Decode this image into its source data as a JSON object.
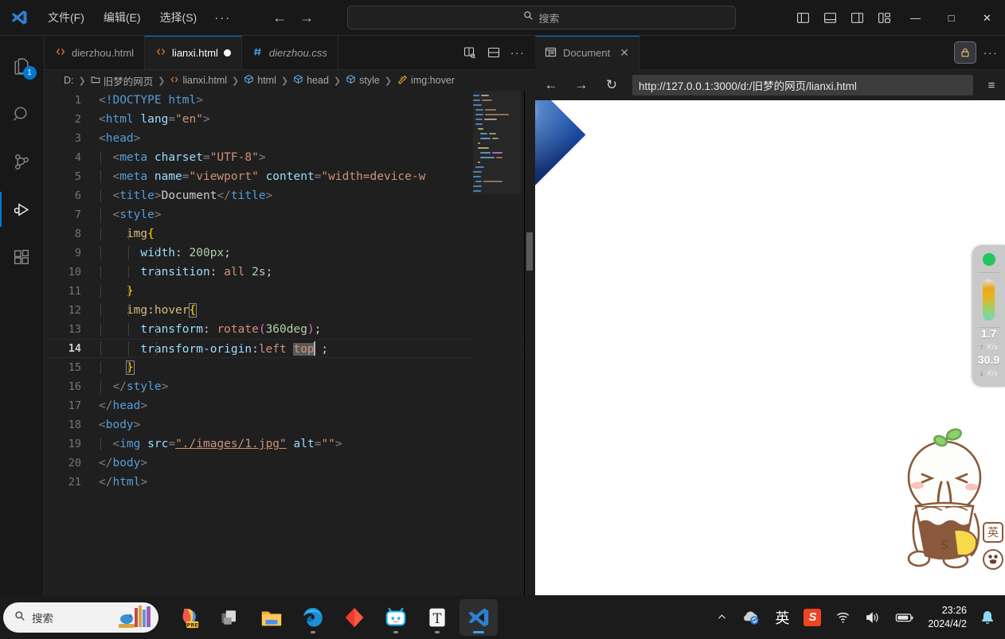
{
  "titlebar": {
    "logo_icon": "vscode-logo-icon",
    "menus": [
      {
        "label": "文件(F)",
        "name": "menu-file"
      },
      {
        "label": "编辑(E)",
        "name": "menu-edit"
      },
      {
        "label": "选择(S)",
        "name": "menu-selection"
      },
      {
        "label": "···",
        "name": "menu-more"
      }
    ],
    "back_arrow": "←",
    "forward_arrow": "→",
    "search": {
      "placeholder": "搜索",
      "icon": "search-icon"
    },
    "layout_buttons": [
      {
        "name": "toggle-primary-sidebar-icon"
      },
      {
        "name": "toggle-panel-icon"
      },
      {
        "name": "toggle-secondary-sidebar-icon"
      },
      {
        "name": "customize-layout-icon"
      }
    ],
    "window_buttons": {
      "minimize": "—",
      "maximize": "□",
      "close": "✕"
    }
  },
  "activitybar": {
    "items": [
      {
        "name": "sidebar-item-explorer",
        "icon": "files-icon",
        "badge": "1",
        "active": false
      },
      {
        "name": "sidebar-item-search",
        "icon": "search-icon",
        "badge": "",
        "active": false
      },
      {
        "name": "sidebar-item-source-control",
        "icon": "source-control-icon",
        "badge": "",
        "active": false
      },
      {
        "name": "sidebar-item-run-debug",
        "icon": "run-and-debug-icon",
        "badge": "",
        "active": true
      },
      {
        "name": "sidebar-item-extensions",
        "icon": "extensions-icon",
        "badge": "",
        "active": false
      }
    ]
  },
  "editor": {
    "tabs": [
      {
        "label": "dierzhou.html",
        "icon": "html-file-icon",
        "active": false,
        "dirty": false,
        "italic": false
      },
      {
        "label": "lianxi.html",
        "icon": "html-file-icon",
        "active": true,
        "dirty": true,
        "italic": false
      },
      {
        "label": "dierzhou.css",
        "icon": "css-file-icon",
        "active": false,
        "dirty": false,
        "italic": true
      }
    ],
    "tab_actions": [
      {
        "name": "split-editor-icon"
      },
      {
        "name": "split-editor-down-icon"
      },
      {
        "name": "editor-more-actions-icon"
      }
    ],
    "breadcrumb": [
      {
        "label": "D:",
        "icon": ""
      },
      {
        "label": "旧梦的网页",
        "icon": "folder-icon"
      },
      {
        "label": "lianxi.html",
        "icon": "html-file-icon"
      },
      {
        "label": "html",
        "icon": "symbol-field-icon"
      },
      {
        "label": "head",
        "icon": "symbol-field-icon"
      },
      {
        "label": "style",
        "icon": "symbol-field-icon"
      },
      {
        "label": "img:hover",
        "icon": "symbol-ruler-icon"
      }
    ],
    "current_line": 14,
    "lines": [
      {
        "n": 1,
        "text": "<!DOCTYPE html>"
      },
      {
        "n": 2,
        "text": "<html lang=\"en\">"
      },
      {
        "n": 3,
        "text": "<head>"
      },
      {
        "n": 4,
        "text": "  <meta charset=\"UTF-8\">"
      },
      {
        "n": 5,
        "text": "  <meta name=\"viewport\" content=\"width=device-w"
      },
      {
        "n": 6,
        "text": "  <title>Document</title>"
      },
      {
        "n": 7,
        "text": "  <style>"
      },
      {
        "n": 8,
        "text": "    img{"
      },
      {
        "n": 9,
        "text": "      width: 200px;"
      },
      {
        "n": 10,
        "text": "      transition: all 2s;"
      },
      {
        "n": 11,
        "text": "    }"
      },
      {
        "n": 12,
        "text": "    img:hover{"
      },
      {
        "n": 13,
        "text": "      transform: rotate(360deg);"
      },
      {
        "n": 14,
        "text": "      transform-origin:left top ;"
      },
      {
        "n": 15,
        "text": "    }"
      },
      {
        "n": 16,
        "text": "  </style>"
      },
      {
        "n": 17,
        "text": "</head>"
      },
      {
        "n": 18,
        "text": "<body>"
      },
      {
        "n": 19,
        "text": "  <img src=\"./images/1.jpg\" alt=\"\">"
      },
      {
        "n": 20,
        "text": "</body>"
      },
      {
        "n": 21,
        "text": "</html>"
      }
    ],
    "selection_text": "top"
  },
  "preview": {
    "tab": {
      "label": "Document",
      "icon": "browser-preview-icon",
      "close_icon": "close-icon"
    },
    "lock_icon": "lock-icon",
    "more_icon": "more-actions-icon",
    "nav": {
      "back": "←",
      "forward": "→",
      "reload": "↻",
      "menu_icon": "browser-menu-icon"
    },
    "url": "http://127.0.0.1:3000/d:/旧梦的网页/lianxi.html",
    "page_image_alt": "rotated-space-image"
  },
  "net_widget": {
    "status_dot_color": "#22c55e",
    "upload_value": "1.7",
    "upload_unit": "K/s",
    "upload_arrow": "↑",
    "download_value": "30.9",
    "download_unit": "K/s",
    "download_arrow": "↓"
  },
  "sticker": {
    "name": "cartoon-character-sticker",
    "ime_badge": "英",
    "ime_badge2": "●"
  },
  "taskbar": {
    "search": {
      "placeholder": "搜索",
      "icon": "search-icon"
    },
    "apps": [
      {
        "name": "taskbar-icon-wps-pre",
        "label": "PRE",
        "running": false
      },
      {
        "name": "taskbar-icon-task-view",
        "label": "",
        "running": false
      },
      {
        "name": "taskbar-icon-file-explorer",
        "label": "",
        "running": false
      },
      {
        "name": "taskbar-icon-edge",
        "label": "",
        "running": true
      },
      {
        "name": "taskbar-icon-red-diamond-app",
        "label": "",
        "running": false
      },
      {
        "name": "taskbar-icon-bilibili",
        "label": "",
        "running": true
      },
      {
        "name": "taskbar-icon-typora",
        "label": "T",
        "running": true
      },
      {
        "name": "taskbar-icon-vscode",
        "label": "",
        "running": true
      }
    ],
    "tray": {
      "chevron": "⌃",
      "cloud_icon": "cloud-sync-icon",
      "ime": "英",
      "sogou": "S",
      "wifi_icon": "wifi-icon",
      "volume_icon": "volume-icon",
      "battery_icon": "battery-icon",
      "time": "23:26",
      "date": "2024/4/2",
      "bell_icon": "notification-bell-icon"
    }
  },
  "colors": {
    "accent": "#0078d4",
    "titlebar_bg": "#181818",
    "editor_bg": "#1f1f1f",
    "tab_active_bg": "#1f1f1f"
  }
}
